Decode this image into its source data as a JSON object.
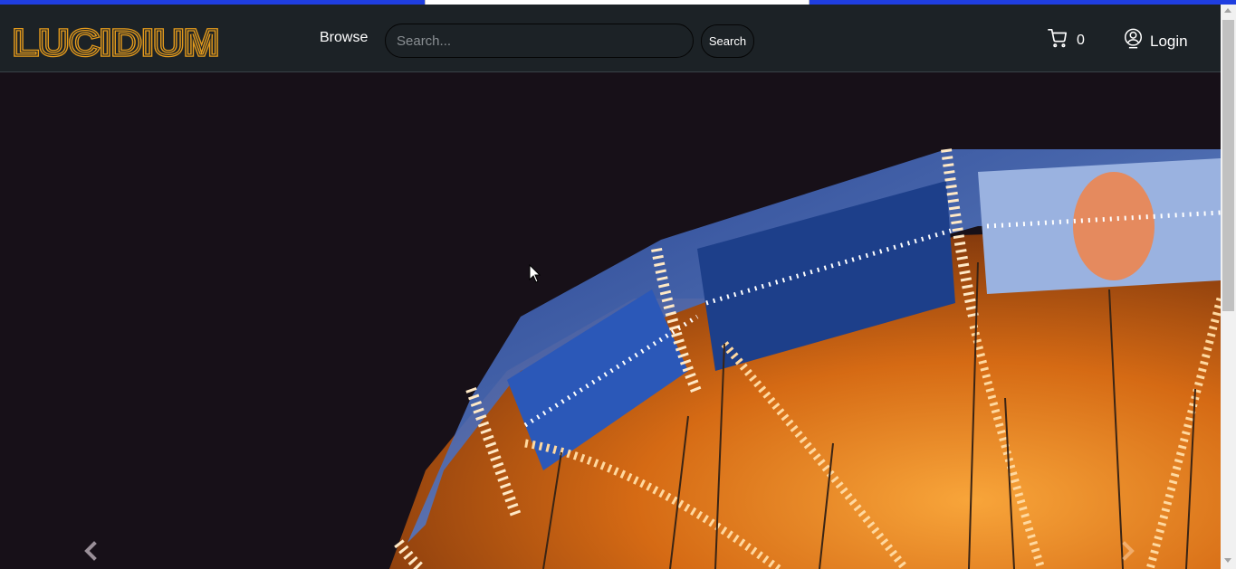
{
  "brand": {
    "name": "LUCIDIUM",
    "color": "#e39a1c"
  },
  "nav": {
    "browse_label": "Browse",
    "search_placeholder": "Search...",
    "search_button_label": "Search",
    "cart_count": "0",
    "login_label": "Login"
  },
  "hero": {
    "image": "carousel-swing-ride-night",
    "prev_icon": "chevron-left-icon",
    "next_icon": "chevron-right-icon"
  },
  "colors": {
    "navbar_bg": "#1c2226",
    "accent_top": "#1f3ee0",
    "hero_bg": "#171018"
  }
}
